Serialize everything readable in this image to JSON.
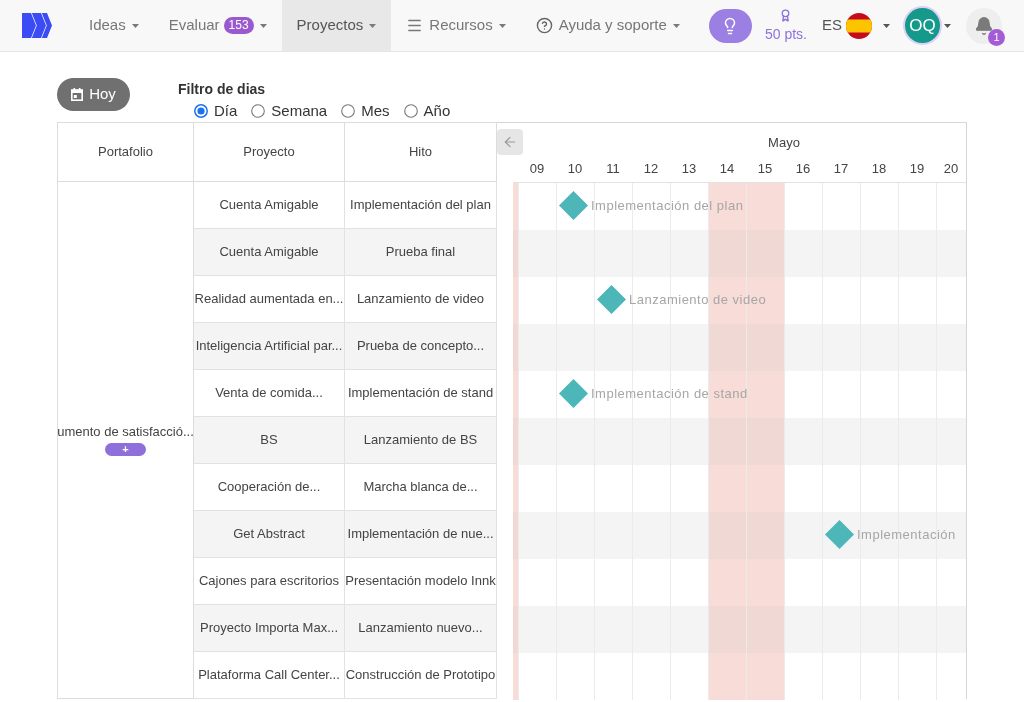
{
  "navbar": {
    "items": [
      {
        "kind": "text",
        "label": "Ideas",
        "selected": false
      },
      {
        "kind": "counter",
        "label": "Evaluar",
        "count": "153",
        "selected": false
      },
      {
        "kind": "text",
        "label": "Proyectos",
        "selected": true
      },
      {
        "kind": "list",
        "label": "Recursos",
        "selected": false
      },
      {
        "kind": "help",
        "label": "Ayuda y soporte",
        "selected": false
      }
    ],
    "points": "50 pts.",
    "language": "ES",
    "user_initials": "OQ",
    "notifications": "1"
  },
  "toolbar": {
    "today_button": "Hoy",
    "day_filter": {
      "title": "Filtro de dias",
      "options": [
        {
          "label": "Día",
          "selected": true
        },
        {
          "label": "Semana",
          "selected": false
        },
        {
          "label": "Mes",
          "selected": false
        },
        {
          "label": "Año",
          "selected": false
        }
      ]
    }
  },
  "table": {
    "columns": [
      "Portafolio",
      "Proyecto",
      "Hito"
    ],
    "portfolio": {
      "name": "umento de satisfacció...",
      "add_button": "+"
    },
    "rows": [
      {
        "project": "Cuenta Amigable",
        "milestone": "Implementación del plan",
        "milestone_marker": {
          "label": "Implementación del plan",
          "marked": [
            false,
            false,
            true,
            false,
            false,
            false,
            false,
            false,
            false,
            false,
            false,
            false,
            false
          ]
        }
      },
      {
        "project": "Cuenta Amigable",
        "milestone": "Prueba final"
      },
      {
        "project": "Realidad aumentada en...",
        "milestone": "Lanzamiento de video",
        "milestone_marker": {
          "label": "Lanzamiento de video",
          "marked": [
            false,
            false,
            false,
            true,
            false,
            false,
            false,
            false,
            false,
            false,
            false,
            false,
            false
          ]
        }
      },
      {
        "project": "Inteligencia Artificial par...",
        "milestone": "Prueba de concepto..."
      },
      {
        "project": "Venta de comida...",
        "milestone": "Implementación de stand",
        "milestone_marker": {
          "label": "Implementación de stand",
          "marked": [
            false,
            false,
            true,
            false,
            false,
            false,
            false,
            false,
            false,
            false,
            false,
            false,
            false
          ]
        }
      },
      {
        "project": "BS",
        "milestone": "Lanzamiento de BS"
      },
      {
        "project": "Cooperación de...",
        "milestone": "Marcha blanca de..."
      },
      {
        "project": "Get Abstract",
        "milestone": "Implementación de nue...",
        "milestone_marker": {
          "label": "Implementación",
          "marked": [
            false,
            false,
            false,
            false,
            false,
            false,
            false,
            false,
            false,
            true,
            false,
            false,
            false
          ]
        }
      },
      {
        "project": "Cajones para escritorios",
        "milestone": "Presentación modelo Innk"
      },
      {
        "project": "Proyecto Importa Max...",
        "milestone": "Lanzamiento nuevo..."
      },
      {
        "project": "Plataforma Call Center...",
        "milestone": "Construcción de Prototipo"
      }
    ]
  },
  "timeline": {
    "month": "Mayo",
    "days": [
      {
        "weekend": true
      },
      {
        "label": "09",
        "weekend": false
      },
      {
        "label": "10",
        "weekend": false
      },
      {
        "label": "11",
        "weekend": false
      },
      {
        "label": "12",
        "weekend": false
      },
      {
        "label": "13",
        "weekend": false
      },
      {
        "label": "14",
        "weekend": true
      },
      {
        "label": "15",
        "weekend": true
      },
      {
        "label": "16",
        "weekend": false
      },
      {
        "label": "17",
        "weekend": false
      },
      {
        "label": "18",
        "weekend": false
      },
      {
        "label": "19",
        "weekend": false
      },
      {
        "label": "20",
        "weekend": false
      }
    ]
  }
}
